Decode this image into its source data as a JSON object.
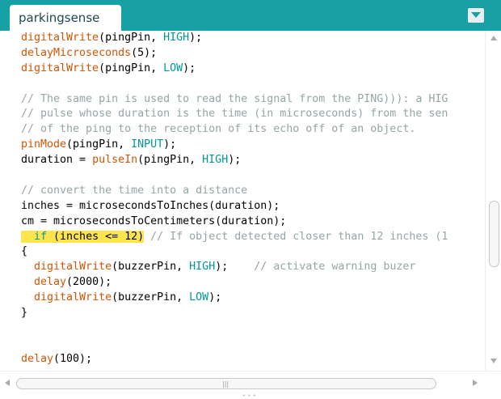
{
  "tab": {
    "label": "parkingsense"
  },
  "code_lines": [
    [
      {
        "t": "digitalWrite",
        "c": "fn"
      },
      {
        "t": "(pingPin, "
      },
      {
        "t": "HIGH",
        "c": "kw"
      },
      {
        "t": ");"
      }
    ],
    [
      {
        "t": "delayMicroseconds",
        "c": "fn"
      },
      {
        "t": "(5);"
      }
    ],
    [
      {
        "t": "digitalWrite",
        "c": "fn"
      },
      {
        "t": "(pingPin, "
      },
      {
        "t": "LOW",
        "c": "kw"
      },
      {
        "t": ");"
      }
    ],
    [],
    [
      {
        "t": "// The same pin is used to read the signal from the PING))): a HIG",
        "c": "cm"
      }
    ],
    [
      {
        "t": "// pulse whose duration is the time (in microseconds) from the sen",
        "c": "cm"
      }
    ],
    [
      {
        "t": "// of the ping to the reception of its echo off of an object.",
        "c": "cm"
      }
    ],
    [
      {
        "t": "pinMode",
        "c": "fn"
      },
      {
        "t": "(pingPin, "
      },
      {
        "t": "INPUT",
        "c": "kw"
      },
      {
        "t": ");"
      }
    ],
    [
      {
        "t": "duration = "
      },
      {
        "t": "pulseIn",
        "c": "fn"
      },
      {
        "t": "(pingPin, "
      },
      {
        "t": "HIGH",
        "c": "kw"
      },
      {
        "t": ");"
      }
    ],
    [],
    [
      {
        "t": "// convert the time into a distance",
        "c": "cm"
      }
    ],
    [
      {
        "t": "inches = microsecondsToInches(duration);"
      }
    ],
    [
      {
        "t": "cm = microsecondsToCentimeters(duration);"
      }
    ],
    [
      {
        "t": "  ",
        "c": "hl"
      },
      {
        "t": "if",
        "c": "kw hl"
      },
      {
        "t": " (inches <= 12)",
        "c": "hl"
      },
      {
        "t": " "
      },
      {
        "t": "// If object detected closer than 12 inches (1",
        "c": "cm"
      }
    ],
    [
      {
        "t": "{"
      }
    ],
    [
      {
        "t": "  "
      },
      {
        "t": "digitalWrite",
        "c": "fn"
      },
      {
        "t": "(buzzerPin, "
      },
      {
        "t": "HIGH",
        "c": "kw"
      },
      {
        "t": ");    "
      },
      {
        "t": "// activate warning buzer",
        "c": "cm"
      }
    ],
    [
      {
        "t": "  "
      },
      {
        "t": "delay",
        "c": "fn"
      },
      {
        "t": "(2000);"
      }
    ],
    [
      {
        "t": "  "
      },
      {
        "t": "digitalWrite",
        "c": "fn"
      },
      {
        "t": "(buzzerPin, "
      },
      {
        "t": "LOW",
        "c": "kw"
      },
      {
        "t": ");"
      }
    ],
    [
      {
        "t": "}"
      }
    ],
    [],
    [],
    [
      {
        "t": "delay",
        "c": "fn"
      },
      {
        "t": "(100);"
      }
    ]
  ],
  "colors": {
    "tabbar": "#17a1a5",
    "function": "#d35400",
    "keyword": "#00979c",
    "comment": "#95a5a6",
    "highlight": "#ffe54d"
  },
  "icons": {
    "tab_menu": "chevron-down-icon",
    "scroll_up": "arrow-up-icon",
    "scroll_down": "arrow-down-icon",
    "scroll_left": "arrow-left-icon",
    "scroll_right": "arrow-right-icon"
  }
}
